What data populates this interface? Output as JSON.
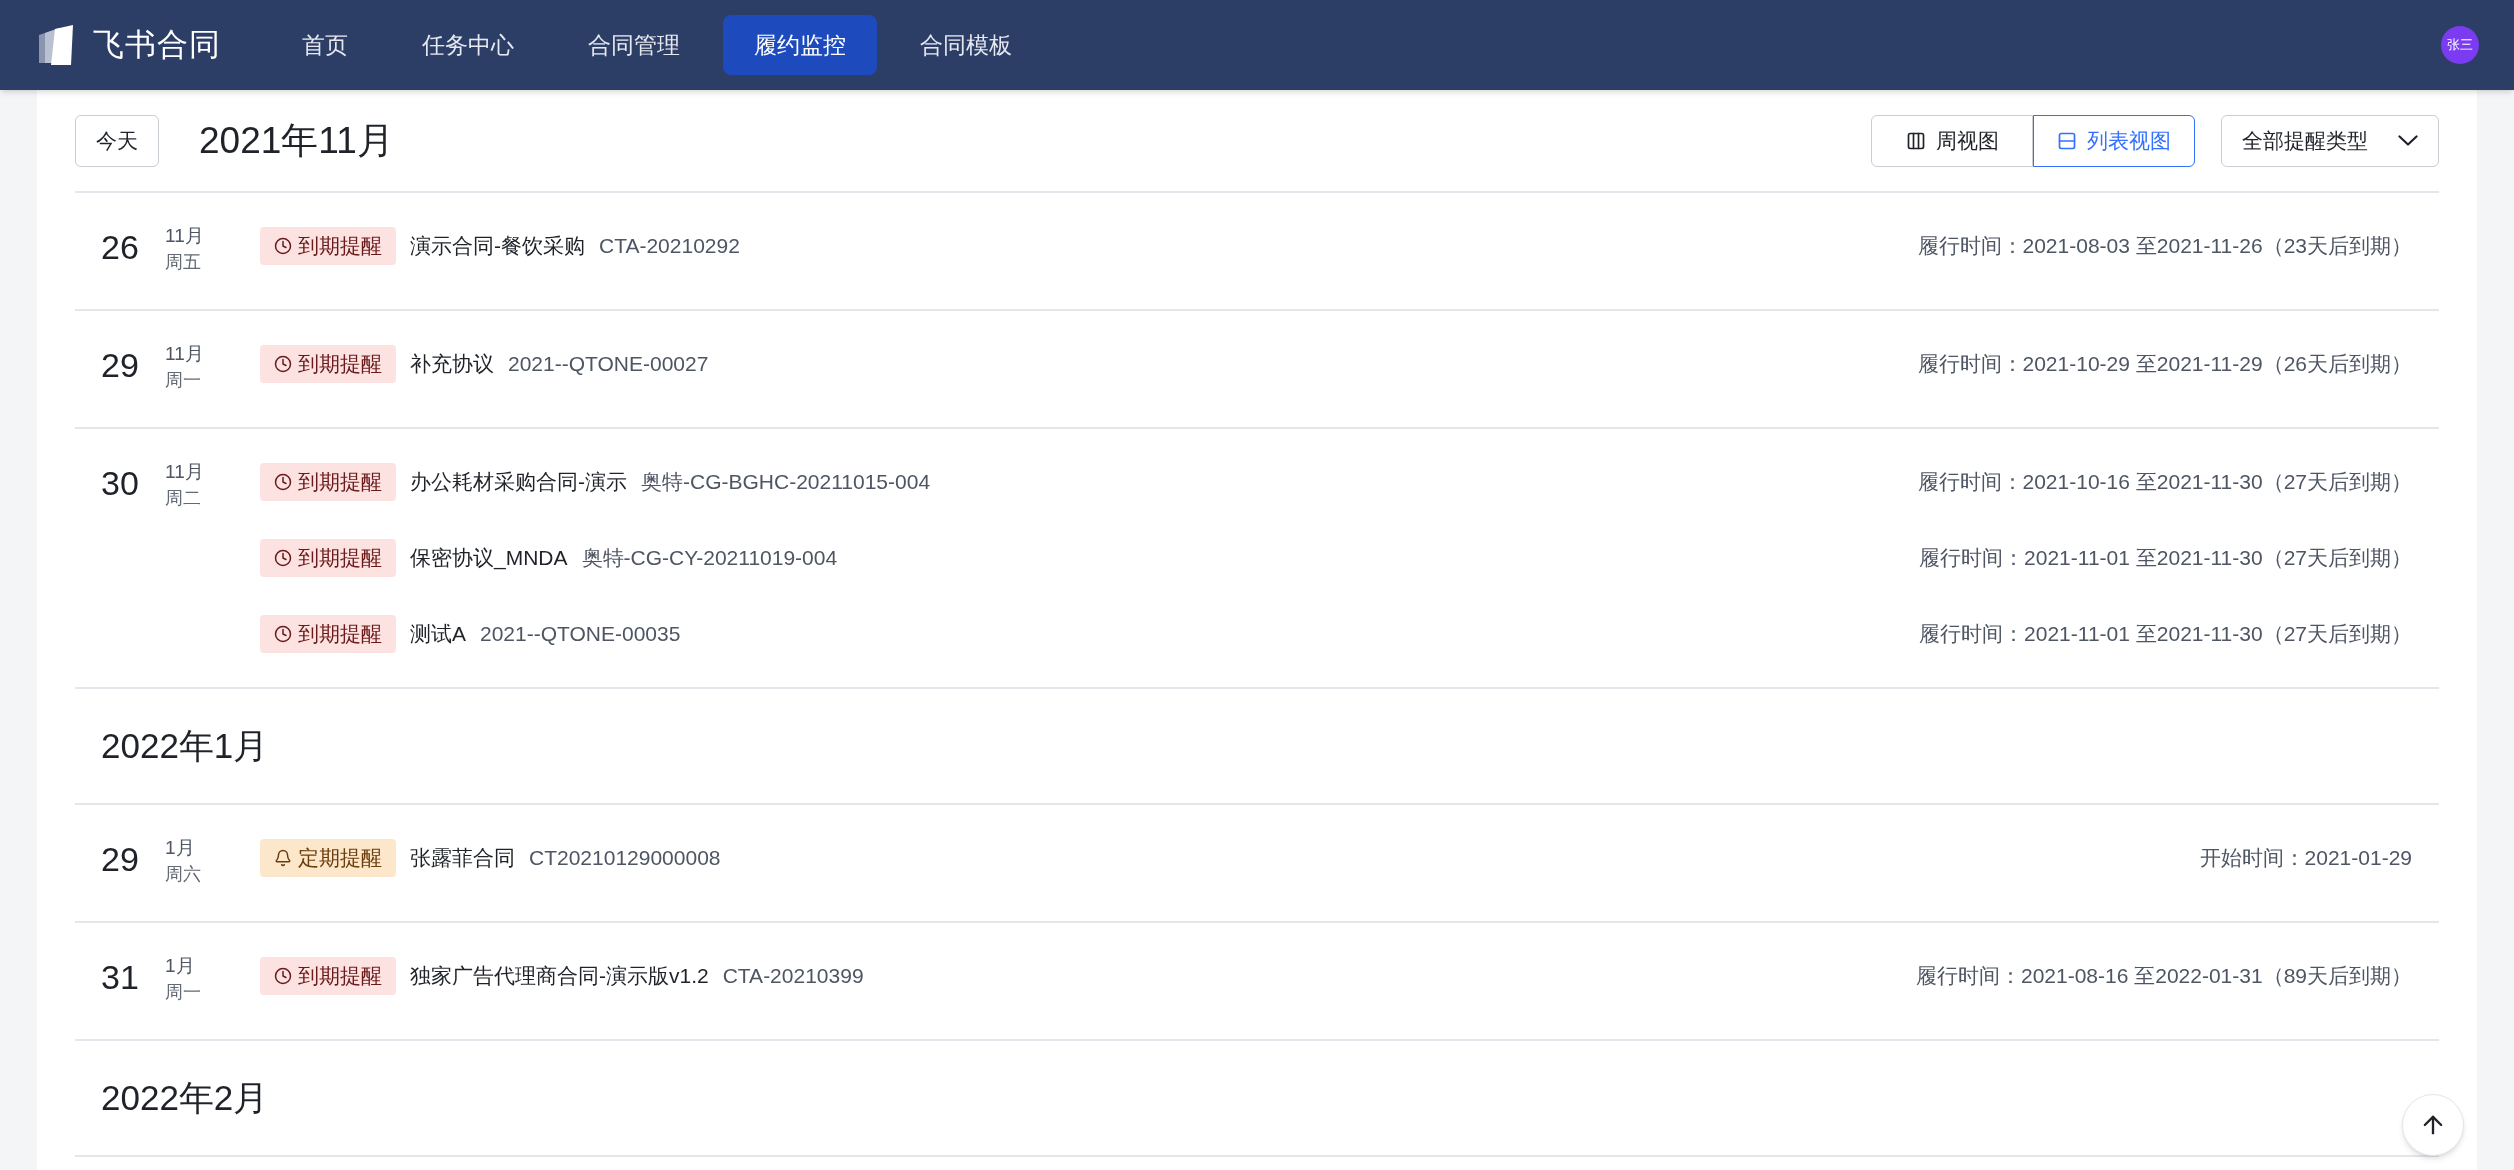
{
  "nav": {
    "logo_text": "飞书合同",
    "items": [
      {
        "label": "首页",
        "selected": false
      },
      {
        "label": "任务中心",
        "selected": false
      },
      {
        "label": "合同管理",
        "selected": false
      },
      {
        "label": "履约监控",
        "selected": true
      },
      {
        "label": "合同模板",
        "selected": false
      }
    ],
    "avatar": "张三"
  },
  "header": {
    "today_button": "今天",
    "title": "2021年11月",
    "views": [
      {
        "kind": "week",
        "label": "周视图",
        "selected": false
      },
      {
        "kind": "list",
        "label": "列表视图",
        "selected": true
      }
    ],
    "filter": "全部提醒类型"
  },
  "sections": [
    {
      "days": [
        {
          "day": "26",
          "month": "11月",
          "weekday": "周五",
          "items": [
            {
              "kind": "expiry",
              "tag": "到期提醒",
              "name": "演示合同-餐饮采购",
              "code": "CTA-20210292",
              "time": "履行时间：2021-08-03 至2021-11-26（23天后到期）"
            }
          ]
        },
        {
          "day": "29",
          "month": "11月",
          "weekday": "周一",
          "items": [
            {
              "kind": "expiry",
              "tag": "到期提醒",
              "name": "补充协议",
              "code": "2021--QTONE-00027",
              "time": "履行时间：2021-10-29 至2021-11-29（26天后到期）"
            }
          ]
        },
        {
          "day": "30",
          "month": "11月",
          "weekday": "周二",
          "items": [
            {
              "kind": "expiry",
              "tag": "到期提醒",
              "name": "办公耗材采购合同-演示",
              "code": "奥特-CG-BGHC-20211015-004",
              "time": "履行时间：2021-10-16 至2021-11-30（27天后到期）"
            },
            {
              "kind": "expiry",
              "tag": "到期提醒",
              "name": "保密协议_MNDA",
              "code": "奥特-CG-CY-20211019-004",
              "time": "履行时间：2021-11-01 至2021-11-30（27天后到期）"
            },
            {
              "kind": "expiry",
              "tag": "到期提醒",
              "name": "测试A",
              "code": "2021--QTONE-00035",
              "time": "履行时间：2021-11-01 至2021-11-30（27天后到期）"
            }
          ]
        }
      ]
    },
    {
      "title": "2022年1月",
      "days": [
        {
          "day": "29",
          "month": "1月",
          "weekday": "周六",
          "items": [
            {
              "kind": "periodic",
              "tag": "定期提醒",
              "name": "张露菲合同",
              "code": "CT20210129000008",
              "time": "开始时间：2021-01-29"
            }
          ]
        },
        {
          "day": "31",
          "month": "1月",
          "weekday": "周一",
          "items": [
            {
              "kind": "expiry",
              "tag": "到期提醒",
              "name": "独家广告代理商合同-演示版v1.2",
              "code": "CTA-20210399",
              "time": "履行时间：2021-08-16 至2022-01-31（89天后到期）"
            }
          ]
        }
      ]
    },
    {
      "title": "2022年2月"
    }
  ]
}
